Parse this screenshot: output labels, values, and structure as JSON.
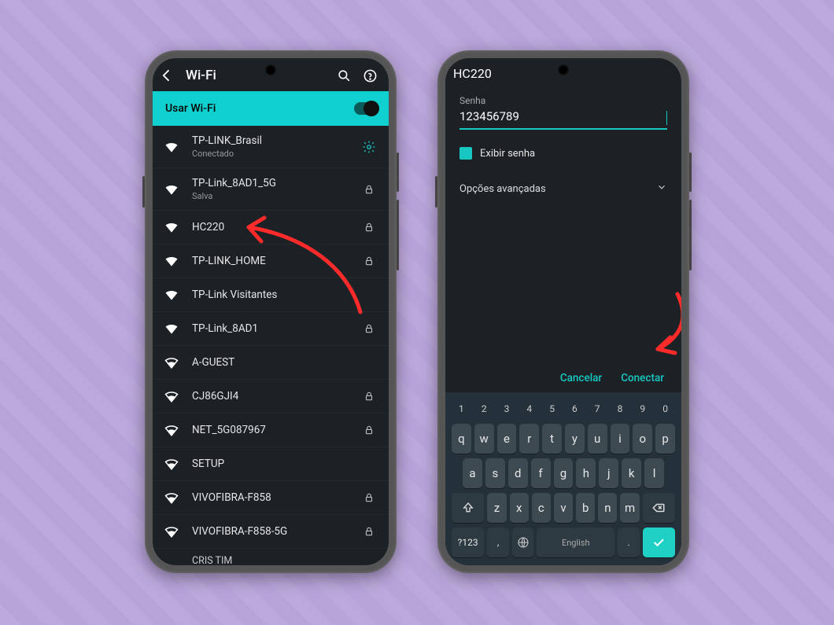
{
  "left": {
    "header": {
      "title": "Wi-Fi"
    },
    "use_wifi_label": "Usar Wi-Fi",
    "connected": {
      "ssid": "TP-LINK_Brasil",
      "status": "Conectado"
    },
    "networks": [
      {
        "ssid": "TP-Link_8AD1_5G",
        "sub": "Salva",
        "signal": "full",
        "locked": true
      },
      {
        "ssid": "HC220",
        "sub": "",
        "signal": "full",
        "locked": true
      },
      {
        "ssid": "TP-LINK_HOME",
        "sub": "",
        "signal": "full",
        "locked": true
      },
      {
        "ssid": "TP-Link Visitantes",
        "sub": "",
        "signal": "full",
        "locked": false
      },
      {
        "ssid": "TP-Link_8AD1",
        "sub": "",
        "signal": "full",
        "locked": true
      },
      {
        "ssid": "A-GUEST",
        "sub": "",
        "signal": "mid",
        "locked": false
      },
      {
        "ssid": "CJ86GJI4",
        "sub": "",
        "signal": "mid",
        "locked": true
      },
      {
        "ssid": "NET_5G087967",
        "sub": "",
        "signal": "mid",
        "locked": true
      },
      {
        "ssid": "SETUP",
        "sub": "",
        "signal": "mid",
        "locked": false
      },
      {
        "ssid": "VIVOFIBRA-F858",
        "sub": "",
        "signal": "mid",
        "locked": true
      },
      {
        "ssid": "VIVOFIBRA-F858-5G",
        "sub": "",
        "signal": "mid",
        "locked": true
      }
    ],
    "last_partial": "CRIS TIM"
  },
  "right": {
    "title": "HC220",
    "password_label": "Senha",
    "password_value": "123456789",
    "show_pwd_label": "Exibir senha",
    "advanced_label": "Opções avançadas",
    "cancel": "Cancelar",
    "connect": "Conectar",
    "keyboard": {
      "numbers": [
        "1",
        "2",
        "3",
        "4",
        "5",
        "6",
        "7",
        "8",
        "9",
        "0"
      ],
      "row1": [
        "q",
        "w",
        "e",
        "r",
        "t",
        "y",
        "u",
        "i",
        "o",
        "p"
      ],
      "row2": [
        "a",
        "s",
        "d",
        "f",
        "g",
        "h",
        "j",
        "k",
        "l"
      ],
      "row3": [
        "z",
        "x",
        "c",
        "v",
        "b",
        "n",
        "m"
      ],
      "symnum": "?123",
      "lang": "English"
    }
  }
}
